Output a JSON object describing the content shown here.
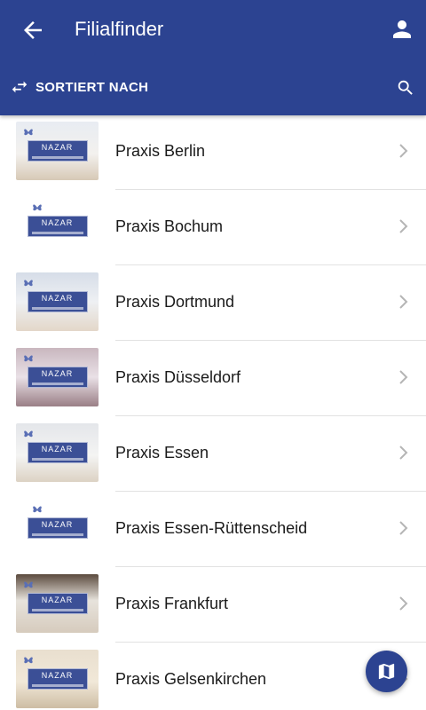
{
  "header": {
    "title": "Filialfinder",
    "sort_label": "SORTIERT NACH",
    "back_icon": "arrow-back-icon",
    "account_icon": "person-icon",
    "sort_icon": "swap-arrows-icon",
    "search_icon": "search-icon"
  },
  "colors": {
    "primary": "#2c4391",
    "text": "#1a1a1a",
    "divider": "#e2e2e2"
  },
  "branches": [
    {
      "label": "Praxis Berlin",
      "logo_text": "NAZAR",
      "thumb": "room"
    },
    {
      "label": "Praxis Bochum",
      "logo_text": "NAZAR",
      "thumb": "plain"
    },
    {
      "label": "Praxis Dortmund",
      "logo_text": "NAZAR",
      "thumb": "room2"
    },
    {
      "label": "Praxis Düsseldorf",
      "logo_text": "NAZAR",
      "thumb": "room3"
    },
    {
      "label": "Praxis Essen",
      "logo_text": "NAZAR",
      "thumb": "room4"
    },
    {
      "label": "Praxis Essen-Rüttenscheid",
      "logo_text": "NAZAR",
      "thumb": "plain"
    },
    {
      "label": "Praxis Frankfurt",
      "logo_text": "NAZAR",
      "thumb": "room5"
    },
    {
      "label": "Praxis Gelsenkirchen",
      "logo_text": "NAZAR",
      "thumb": "room6"
    }
  ],
  "fab": {
    "icon": "map-icon"
  }
}
